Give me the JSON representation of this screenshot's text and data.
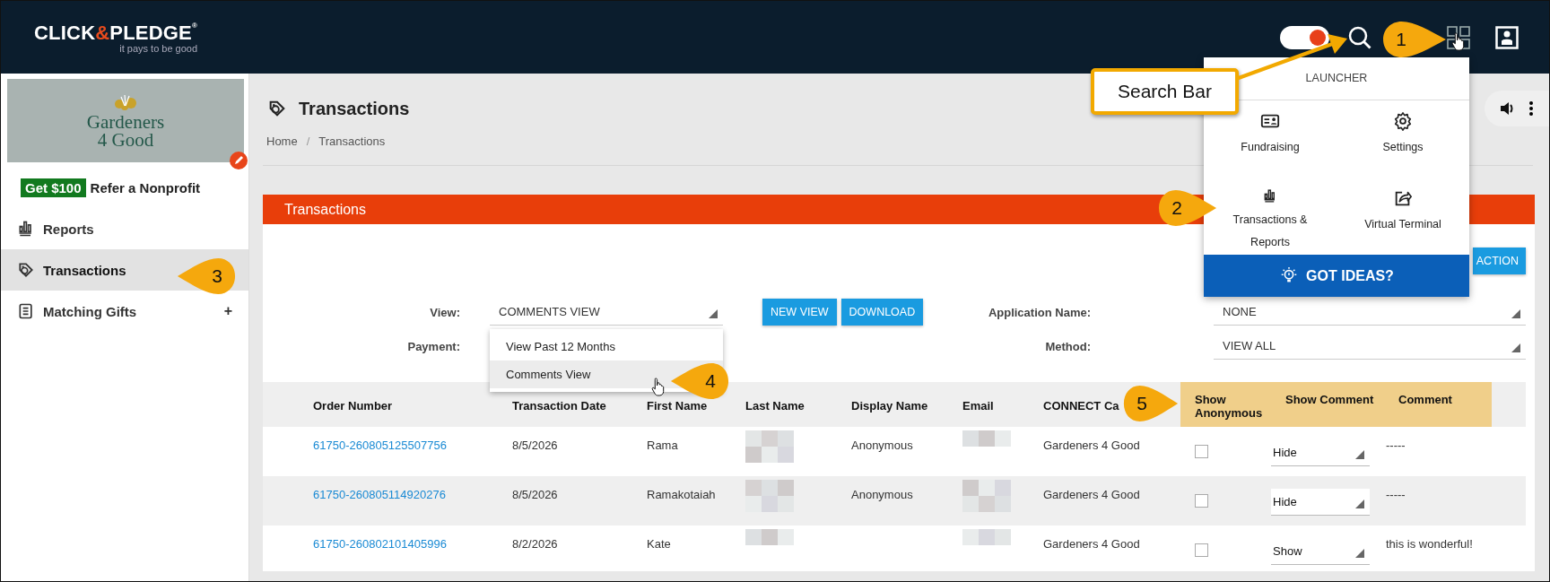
{
  "header": {
    "logo": {
      "left": "CLICK",
      "amp": "&",
      "right": "PLEDGE",
      "mark": "®"
    },
    "tagline": "it pays to be good",
    "toggle": {
      "on": true
    }
  },
  "sidebar": {
    "org_logo": {
      "line1": "Gardeners",
      "line2": "4 Good"
    },
    "promo": {
      "badge": "Get $100",
      "text": "Refer a Nonprofit"
    },
    "items": [
      {
        "label": "Reports",
        "selected": false
      },
      {
        "label": "Transactions",
        "selected": true
      },
      {
        "label": "Matching Gifts",
        "selected": false,
        "expand_label": "+"
      }
    ]
  },
  "page": {
    "title": "Transactions",
    "breadcrumb": [
      "Home",
      "/",
      "Transactions"
    ]
  },
  "panel": {
    "title": "Transactions",
    "action_button": "ACTION",
    "filters_left": [
      {
        "label": "View:",
        "value": "COMMENTS VIEW"
      },
      {
        "label": "Payment:"
      }
    ],
    "buttons": [
      "NEW VIEW",
      "DOWNLOAD"
    ],
    "filters_right": [
      {
        "label": "Application Name:",
        "value": "NONE"
      },
      {
        "label": "Method:",
        "value": "VIEW ALL"
      }
    ],
    "view_menu": [
      {
        "label": "View Past 12 Months",
        "selected": false
      },
      {
        "label": "Comments View",
        "selected": true
      }
    ]
  },
  "table": {
    "columns": [
      {
        "label": "Order Number",
        "highlighted": false
      },
      {
        "label": "Transaction Date",
        "highlighted": false
      },
      {
        "label": "First Name",
        "highlighted": false
      },
      {
        "label": "Last Name",
        "highlighted": false
      },
      {
        "label": "Display Name",
        "highlighted": false
      },
      {
        "label": "Email",
        "highlighted": false
      },
      {
        "label": "CONNECT Ca",
        "highlighted": false
      },
      {
        "label": "Show Anonymous",
        "highlighted": true
      },
      {
        "label": "Show Comment",
        "highlighted": true
      },
      {
        "label": "Comment",
        "highlighted": true
      }
    ],
    "rows": [
      {
        "order": "61750-260805125507756",
        "date": "8/5/2026",
        "first_name": "Rama",
        "display_name": "Anonymous",
        "connect": "Gardeners 4 Good",
        "show_anonymous": false,
        "show_comment": "Hide",
        "comment": "-----",
        "hovered": false
      },
      {
        "order": "61750-260805114920276",
        "date": "8/5/2026",
        "first_name": "Ramakotaiah",
        "display_name": "Anonymous",
        "connect": "Gardeners 4 Good",
        "show_anonymous": false,
        "show_comment": "Hide",
        "comment": "-----",
        "hovered": true
      },
      {
        "order": "61750-260802101405996",
        "date": "8/2/2026",
        "first_name": "Kate",
        "connect": "Gardeners 4 Good",
        "show_anonymous": false,
        "show_comment": "Show",
        "comment": "this is wonderful!",
        "hovered": false
      }
    ]
  },
  "launcher": {
    "title": "LAUNCHER",
    "items": [
      {
        "label": "Fundraising"
      },
      {
        "label": "Settings"
      },
      {
        "label": "Transactions & Reports"
      },
      {
        "label": "Virtual Terminal"
      }
    ],
    "footer": "GOT IDEAS?"
  },
  "annotations": {
    "search_label": "Search Bar",
    "callouts": [
      {
        "number": "1",
        "kind": "right"
      },
      {
        "number": "2",
        "kind": "right"
      },
      {
        "number": "3",
        "kind": "left"
      },
      {
        "number": "4",
        "kind": "left"
      },
      {
        "number": "5",
        "kind": "right"
      }
    ]
  }
}
